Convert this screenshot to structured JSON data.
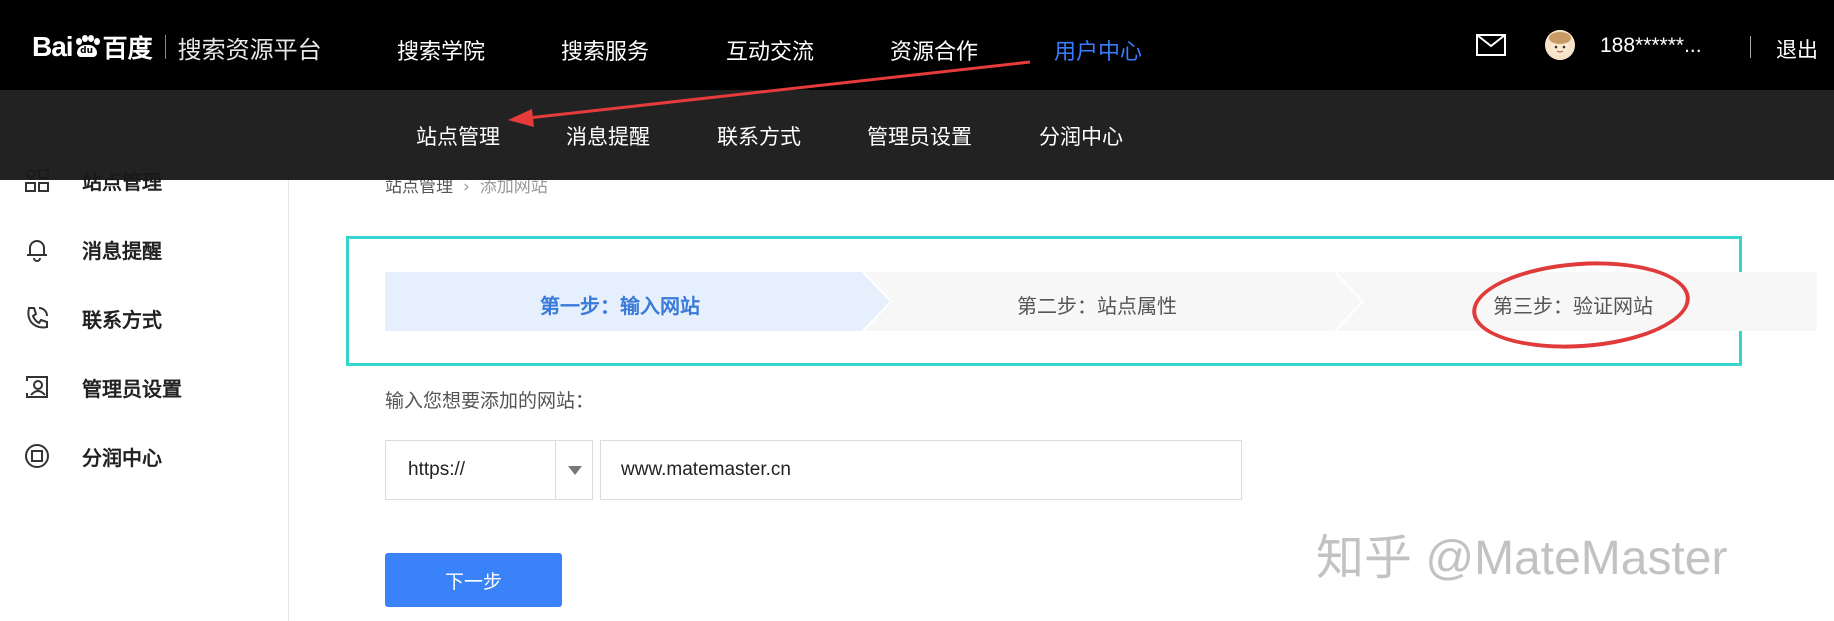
{
  "header": {
    "logo_text": "Bai",
    "logo_paw_text": "du",
    "logo_cn": "百度",
    "platform": "搜索资源平台",
    "nav": [
      {
        "label": "搜索学院"
      },
      {
        "label": "搜索服务"
      },
      {
        "label": "互动交流"
      },
      {
        "label": "资源合作"
      },
      {
        "label": "用户中心",
        "active": true
      }
    ],
    "username": "188******...",
    "logout": "退出",
    "active_color": "#3a7cff"
  },
  "subnav": {
    "items": [
      "站点管理",
      "消息提醒",
      "联系方式",
      "管理员设置",
      "分润中心"
    ]
  },
  "sidebar": {
    "items": [
      {
        "label": "站点管理",
        "icon": "site-manage-icon"
      },
      {
        "label": "消息提醒",
        "icon": "bell-icon"
      },
      {
        "label": "联系方式",
        "icon": "phone-icon"
      },
      {
        "label": "管理员设置",
        "icon": "admin-icon"
      },
      {
        "label": "分润中心",
        "icon": "revenue-icon"
      }
    ]
  },
  "breadcrumb": {
    "root": "站点管理",
    "sep": "›",
    "current": "添加网站"
  },
  "steps": [
    {
      "label": "第一步：输入网站",
      "active": true
    },
    {
      "label": "第二步：站点属性"
    },
    {
      "label": "第三步：验证网站"
    }
  ],
  "form": {
    "prompt": "输入您想要添加的网站：",
    "protocol": "https://",
    "url": "www.matemaster.cn",
    "next_label": "下一步"
  },
  "watermark": "知乎 @MateMaster",
  "colors": {
    "accent": "#3a82f7",
    "step_box": "#34d6cf",
    "annotation": "#e03a3a"
  }
}
